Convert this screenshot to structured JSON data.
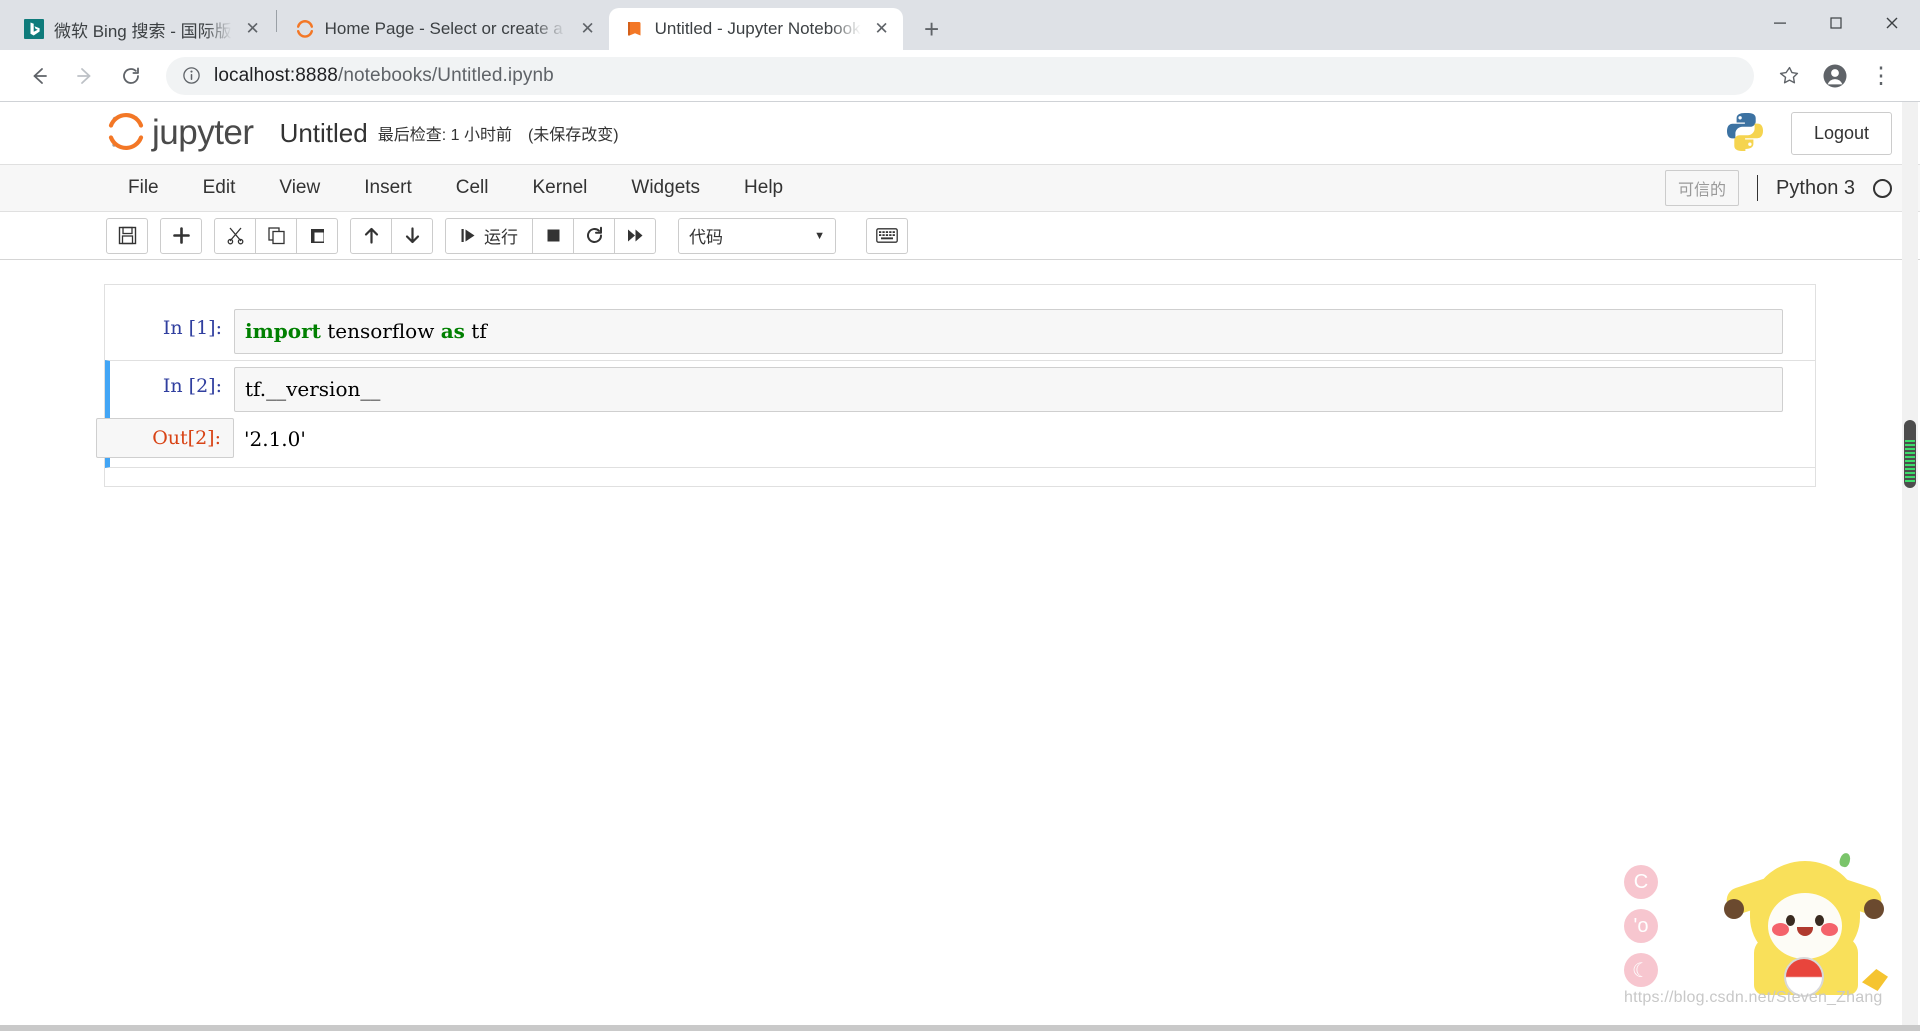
{
  "browser": {
    "tabs": [
      {
        "title": "微软 Bing 搜索 - 国际版",
        "favicon": "bing-icon",
        "active": false,
        "close_label": "✕"
      },
      {
        "title": "Home Page - Select or create a notebook",
        "favicon": "jupyter-icon",
        "active": false,
        "close_label": "✕"
      },
      {
        "title": "Untitled - Jupyter Notebook",
        "favicon": "notebook-icon",
        "active": true,
        "close_label": "✕"
      }
    ],
    "newtab_label": "+",
    "window_controls": {
      "minimize": "—",
      "maximize": "▢",
      "close": "✕"
    },
    "nav": {
      "back": "←",
      "forward": "→",
      "reload": "⟳"
    },
    "omnibox": {
      "info_icon": "ⓘ",
      "host": "localhost:8888",
      "path": "/notebooks/Untitled.ipynb",
      "star_icon": "☆",
      "profile_icon": "person-icon",
      "menu_icon": "⋮"
    }
  },
  "jupyter": {
    "logo_text": "jupyter",
    "notebook_name": "Untitled",
    "checkpoint_text": "最后检查: 1 小时前",
    "modified_text": "(未保存改变)",
    "logout_label": "Logout",
    "python_logo": "python-icon",
    "menubar": [
      "File",
      "Edit",
      "View",
      "Insert",
      "Cell",
      "Kernel",
      "Widgets",
      "Help"
    ],
    "trusted_label": "可信的",
    "kernel_name": "Python 3",
    "toolbar": {
      "save_icon": "💾",
      "add_icon": "✚",
      "cut_icon": "✂",
      "copy_icon": "copy-icon",
      "paste_icon": "paste-icon",
      "move_up_icon": "↑",
      "move_down_icon": "↓",
      "run_icon": "▶|",
      "run_label": "运行",
      "stop_icon": "◼",
      "restart_icon": "⟳",
      "restart_run_all_icon": "⏩",
      "cell_type": "代码",
      "cell_type_caret": "▼",
      "command_palette_icon": "⌨"
    }
  },
  "cells": [
    {
      "prompt": "In [1]:",
      "type": "code",
      "selected": false,
      "source_tokens": [
        {
          "text": "import",
          "kind": "kw"
        },
        {
          "text": " tensorflow ",
          "kind": "plain"
        },
        {
          "text": "as",
          "kind": "kw"
        },
        {
          "text": " tf",
          "kind": "plain"
        }
      ],
      "output": null
    },
    {
      "prompt": "In [2]:",
      "type": "code",
      "selected": true,
      "source_tokens": [
        {
          "text": "tf.__version__",
          "kind": "plain"
        }
      ],
      "output": {
        "prompt": "Out[2]:",
        "text": "'2.1.0'"
      }
    }
  ],
  "watermark": {
    "url": "https://blog.csdn.net/Steven_Zhang",
    "bubbles": [
      "C",
      "'o",
      "☾"
    ]
  }
}
